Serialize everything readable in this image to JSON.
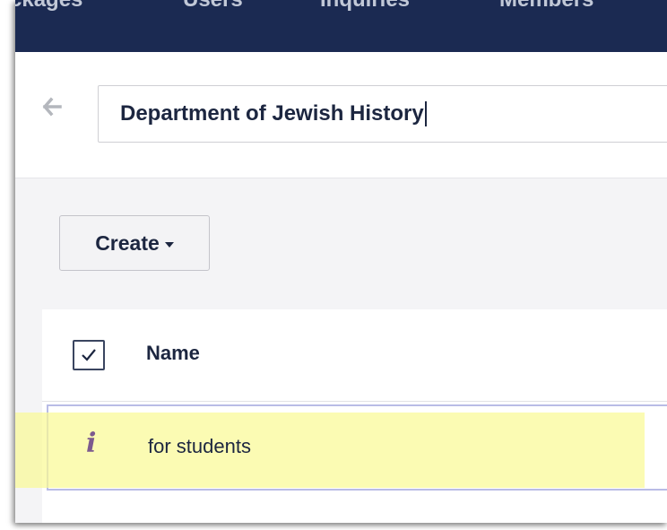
{
  "nav": {
    "items": [
      "ckages",
      "Users",
      "Inquiries",
      "Members"
    ]
  },
  "header": {
    "title_value": "Department of Jewish History"
  },
  "toolbar": {
    "create_label": "Create"
  },
  "table": {
    "columns": [
      "Name"
    ],
    "select_all_checked": true,
    "rows": [
      {
        "icon": "info-icon",
        "name": "for students"
      }
    ]
  },
  "icons": {
    "back": "arrow-left-icon",
    "dropdown": "caret-down-icon",
    "check": "checkmark-icon",
    "info_glyph": "i"
  },
  "colors": {
    "nav_bg": "#1b2a52",
    "text_dark": "#1c2640",
    "info_icon": "#7c5a8e",
    "row_highlight": "#fafa96",
    "row_border": "#b9bce6"
  }
}
